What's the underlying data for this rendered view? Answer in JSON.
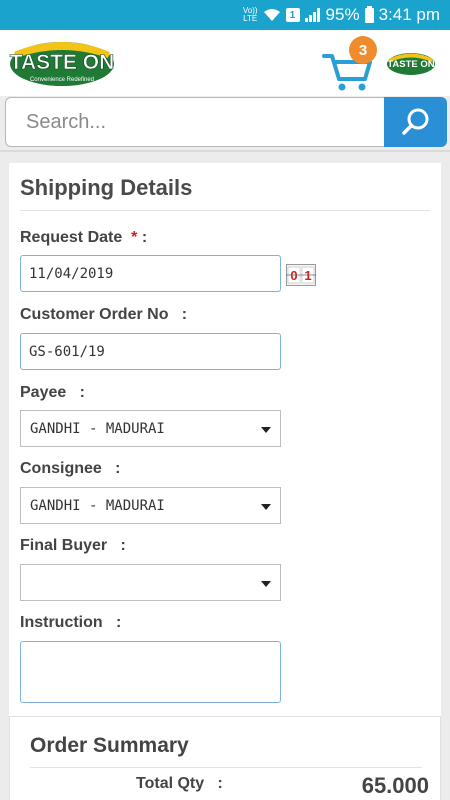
{
  "status_bar": {
    "volte_line1": "Vo))",
    "volte_line2": "LTE",
    "sim_number": "1",
    "battery": "95%",
    "time": "3:41 pm"
  },
  "header": {
    "logo_text": "TASTE ON",
    "logo_tagline": "Convenience Redefined",
    "cart_count": "3",
    "brand_color": "#1aa3cc"
  },
  "search": {
    "placeholder": "Search..."
  },
  "shipping": {
    "title": "Shipping Details",
    "fields": {
      "request_date": {
        "label": "Request Date",
        "required_mark": "*",
        "colon": " :",
        "value": "11/04/2019"
      },
      "customer_order_no": {
        "label": "Customer Order No   :",
        "value": "GS-601/19"
      },
      "payee": {
        "label": "Payee   :",
        "value": "GANDHI - MADURAI"
      },
      "consignee": {
        "label": "Consignee   :",
        "value": "GANDHI - MADURAI"
      },
      "final_buyer": {
        "label": "Final Buyer   :",
        "value": ""
      },
      "instruction": {
        "label": "Instruction   :",
        "value": ""
      }
    },
    "calendar_icon_text": "0|1"
  },
  "summary": {
    "title": "Order Summary",
    "total_qty_label": "Total Qty   :",
    "total_qty_value": "65.000"
  }
}
